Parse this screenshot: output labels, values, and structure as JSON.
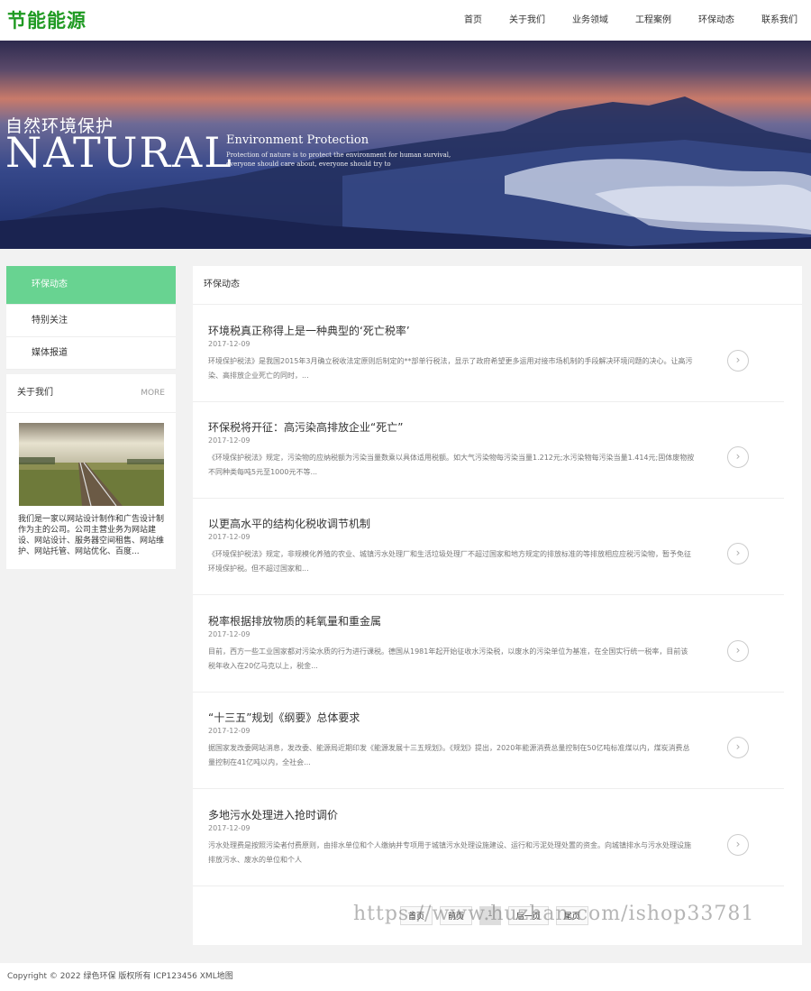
{
  "header": {
    "logo": "节能能源",
    "nav": [
      "首页",
      "关于我们",
      "业务领域",
      "工程案例",
      "环保动态",
      "联系我们"
    ]
  },
  "banner": {
    "cn_title": "自然环境保护",
    "big_title": "NATURAL",
    "env_title": "Environment Protection",
    "small_text": "Protection of nature is to protect the environment for human survival, everyone should care about, everyone should try to"
  },
  "sidebar": {
    "menu": [
      "环保动态",
      "特别关注",
      "媒体报道"
    ],
    "about_title": "关于我们",
    "about_more": "MORE",
    "about_text": "我们是一家以网站设计制作和广告设计制作为主的公司。公司主营业务为网站建设、网站设计、服务器空间租售、网站维护、网站托管、网站优化、百度..."
  },
  "main": {
    "section_title": "环保动态",
    "articles": [
      {
        "title": "环境税真正称得上是一种典型的‘死亡税率’",
        "date": "2017-12-09",
        "summary": "环境保护税法》是我国2015年3月确立税收法定原则后制定的**部单行税法，显示了政府希望更多运用对接市场机制的手段解决环境问题的决心。让高污染、高排放企业死亡的同时，..."
      },
      {
        "title": "环保税将开征：高污染高排放企业“死亡”",
        "date": "2017-12-09",
        "summary": "《环境保护税法》规定，污染物的应纳税额为污染当量数乘以具体适用税额。如大气污染物每污染当量1.212元;水污染物每污染当量1.414元;固体废物按不同种类每吨5元至1000元不等..."
      },
      {
        "title": "以更高水平的结构化税收调节机制",
        "date": "2017-12-09",
        "summary": "《环境保护税法》规定，非规模化养殖的农业、城镇污水处理厂和生活垃圾处理厂不超过国家和地方规定的排放标准的等排放相应应税污染物，暂予免征环境保护税。但不超过国家和..."
      },
      {
        "title": "税率根据排放物质的耗氧量和重金属",
        "date": "2017-12-09",
        "summary": "目前，西方一些工业国家都对污染水质的行为进行课税。德国从1981年起开始征收水污染税，以废水的污染单位为基准，在全国实行统一税率，目前该税年收入在20亿马克以上，税金..."
      },
      {
        "title": "“十三五”规划《纲要》总体要求",
        "date": "2017-12-09",
        "summary": "据国家发改委网站消息，发改委、能源局近期印发《能源发展十三五规划》。《规划》提出，2020年能源消费总量控制在50亿吨标准煤以内，煤炭消费总量控制在41亿吨以内，全社会..."
      },
      {
        "title": "多地污水处理进入抢时调价",
        "date": "2017-12-09",
        "summary": "污水处理费是按照污染者付费原则，由排水单位和个人缴纳并专项用于城镇污水处理设施建设、运行和污泥处理处置的资金。向城镇排水与污水处理设施排放污水、废水的单位和个人"
      }
    ],
    "pager": [
      "首页",
      "前页",
      "1",
      "后一页",
      "尾页"
    ]
  },
  "watermark": "https://www.huzhan.com/ishop33781",
  "footer": "Copyright © 2022 绿色环保 版权所有  ICP123456 XML地图"
}
